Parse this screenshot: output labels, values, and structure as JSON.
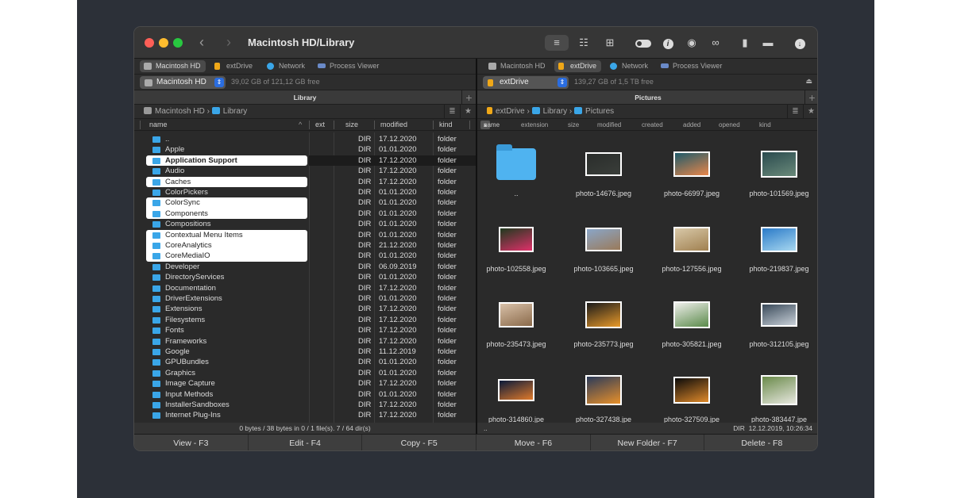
{
  "window": {
    "title": "Macintosh HD/Library"
  },
  "toolbar": {
    "icons": [
      "list-view-icon",
      "detail-view-icon",
      "thumbnail-view-icon",
      "toggle-icon",
      "info-icon",
      "eye-icon",
      "binoculars-icon",
      "archive-icon",
      "network-folder-icon",
      "download-icon"
    ]
  },
  "tabs": [
    "Macintosh HD",
    "extDrive",
    "Network",
    "Process Viewer"
  ],
  "left": {
    "active_tab": 0,
    "drive": "Macintosh HD",
    "free": "39,02 GB of 121,12 GB free",
    "panel_title": "Library",
    "path": [
      "Macintosh HD",
      "Library"
    ],
    "columns": [
      "name",
      "ext",
      "size",
      "modified",
      "kind"
    ],
    "rows": [
      [
        "..",
        "DIR",
        "17.12.2020",
        "folder"
      ],
      [
        "Apple",
        "DIR",
        "01.01.2020",
        "folder"
      ],
      [
        "Application Support",
        "DIR",
        "17.12.2020",
        "folder"
      ],
      [
        "Audio",
        "DIR",
        "17.12.2020",
        "folder"
      ],
      [
        "Caches",
        "DIR",
        "17.12.2020",
        "folder"
      ],
      [
        "ColorPickers",
        "DIR",
        "01.01.2020",
        "folder"
      ],
      [
        "ColorSync",
        "DIR",
        "01.01.2020",
        "folder"
      ],
      [
        "Components",
        "DIR",
        "01.01.2020",
        "folder"
      ],
      [
        "Compositions",
        "DIR",
        "01.01.2020",
        "folder"
      ],
      [
        "Contextual Menu Items",
        "DIR",
        "01.01.2020",
        "folder"
      ],
      [
        "CoreAnalytics",
        "DIR",
        "21.12.2020",
        "folder"
      ],
      [
        "CoreMediaIO",
        "DIR",
        "01.01.2020",
        "folder"
      ],
      [
        "Developer",
        "DIR",
        "06.09.2019",
        "folder"
      ],
      [
        "DirectoryServices",
        "DIR",
        "01.01.2020",
        "folder"
      ],
      [
        "Documentation",
        "DIR",
        "17.12.2020",
        "folder"
      ],
      [
        "DriverExtensions",
        "DIR",
        "01.01.2020",
        "folder"
      ],
      [
        "Extensions",
        "DIR",
        "17.12.2020",
        "folder"
      ],
      [
        "Filesystems",
        "DIR",
        "17.12.2020",
        "folder"
      ],
      [
        "Fonts",
        "DIR",
        "17.12.2020",
        "folder"
      ],
      [
        "Frameworks",
        "DIR",
        "17.12.2020",
        "folder"
      ],
      [
        "Google",
        "DIR",
        "11.12.2019",
        "folder"
      ],
      [
        "GPUBundles",
        "DIR",
        "01.01.2020",
        "folder"
      ],
      [
        "Graphics",
        "DIR",
        "01.01.2020",
        "folder"
      ],
      [
        "Image Capture",
        "DIR",
        "17.12.2020",
        "folder"
      ],
      [
        "Input Methods",
        "DIR",
        "01.01.2020",
        "folder"
      ],
      [
        "InstallerSandboxes",
        "DIR",
        "17.12.2020",
        "folder"
      ],
      [
        "Internet Plug-Ins",
        "DIR",
        "17.12.2020",
        "folder"
      ]
    ],
    "selected": [
      2,
      4,
      6,
      7,
      9,
      10,
      11
    ],
    "cursor": 2,
    "status": "0 bytes / 38 bytes in 0 / 1 file(s). 7 / 64 dir(s)"
  },
  "right": {
    "active_tab": 1,
    "drive": "extDrive",
    "free": "139,27 GB of 1,5 TB free",
    "panel_title": "Pictures",
    "path": [
      "extDrive",
      "Library",
      "Pictures"
    ],
    "columns": [
      "name",
      "extension",
      "size",
      "modified",
      "created",
      "added",
      "opened",
      "kind"
    ],
    "items": [
      {
        "name": "..",
        "colors": [
          "#4fb3f0",
          "#4fb3f0"
        ]
      },
      {
        "name": "photo-14676.jpeg",
        "colors": [
          "#2a2d2b",
          "#3a3e3a"
        ]
      },
      {
        "name": "photo-66997.jpeg",
        "colors": [
          "#1e5a6a",
          "#e8864a"
        ]
      },
      {
        "name": "photo-101569.jpeg",
        "colors": [
          "#2a4a4e",
          "#6a8a7a"
        ]
      },
      {
        "name": "photo-102558.jpeg",
        "colors": [
          "#1e3a1e",
          "#e0306a"
        ]
      },
      {
        "name": "photo-103665.jpeg",
        "colors": [
          "#8aa6c8",
          "#9a7a5a"
        ]
      },
      {
        "name": "photo-127556.jpeg",
        "colors": [
          "#d8c8a8",
          "#a08050"
        ]
      },
      {
        "name": "photo-219837.jpeg",
        "colors": [
          "#2a7ac8",
          "#a8d8f0"
        ]
      },
      {
        "name": "photo-235473.jpeg",
        "colors": [
          "#d8c0a8",
          "#8a6a4a"
        ]
      },
      {
        "name": "photo-235773.jpeg",
        "colors": [
          "#1a1a1a",
          "#e89a2a"
        ]
      },
      {
        "name": "photo-305821.jpeg",
        "colors": [
          "#eeeeea",
          "#5a8a4a"
        ]
      },
      {
        "name": "photo-312105.jpeg",
        "colors": [
          "#3a4a5a",
          "#c8d0d8"
        ]
      },
      {
        "name": "photo-314860.jpe",
        "colors": [
          "#0a1a3a",
          "#e07a2a"
        ]
      },
      {
        "name": "photo-327438.jpe",
        "colors": [
          "#2a3a5a",
          "#e8902a"
        ]
      },
      {
        "name": "photo-327509.jpe",
        "colors": [
          "#0a0a0a",
          "#e08a2a"
        ]
      },
      {
        "name": "photo-383447.jpe",
        "colors": [
          "#6a8a4a",
          "#e8e8e0"
        ]
      }
    ],
    "status_left": "..",
    "status_right": "DIR  12.12.2019, 10:26:34"
  },
  "fkeys": [
    "View - F3",
    "Edit - F4",
    "Copy - F5",
    "Move - F6",
    "New Folder - F7",
    "Delete - F8"
  ],
  "colors": {
    "folder": "#3aa6e8",
    "accent": "#2a6de0",
    "drive_orange": "#f0a818"
  }
}
